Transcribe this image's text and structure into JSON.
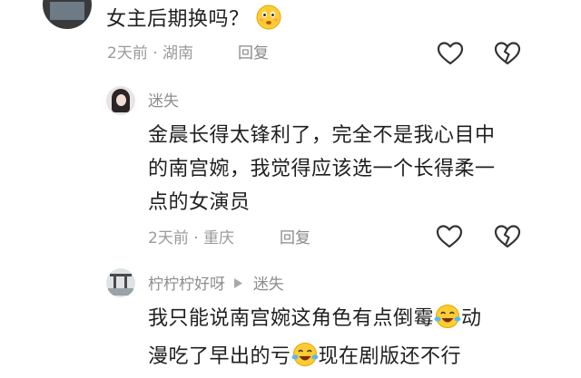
{
  "comments": [
    {
      "text": "女主后期换吗？",
      "emoji": "smile-emoji",
      "meta": "2天前 · 湖南",
      "reply_label": "回复"
    },
    {
      "username": "迷失",
      "lines": [
        "金晨长得太锋利了，完全不是我心目中",
        "的南宫婉，我觉得应该选一个长得柔一",
        "点的女演员"
      ],
      "meta": "2天前 · 重庆",
      "reply_label": "回复"
    },
    {
      "username": "柠柠柠好呀",
      "reply_to": "迷失",
      "line1_a": "我只能说南宫婉这角色有点倒霉",
      "line1_b": "动",
      "line2_a": "漫吃了早出的亏",
      "line2_b": "现在剧版还不行"
    }
  ],
  "icons": {
    "like": "heart-outline-icon",
    "dislike": "broken-heart-outline-icon",
    "reply_arrow": "play-triangle-icon",
    "emoji_1": "smiling-face-emoji",
    "emoji_2": "crying-laughing-emoji"
  },
  "colors": {
    "text": "#1f1f1f",
    "meta": "#9a9a9a",
    "icon": "#333333"
  }
}
